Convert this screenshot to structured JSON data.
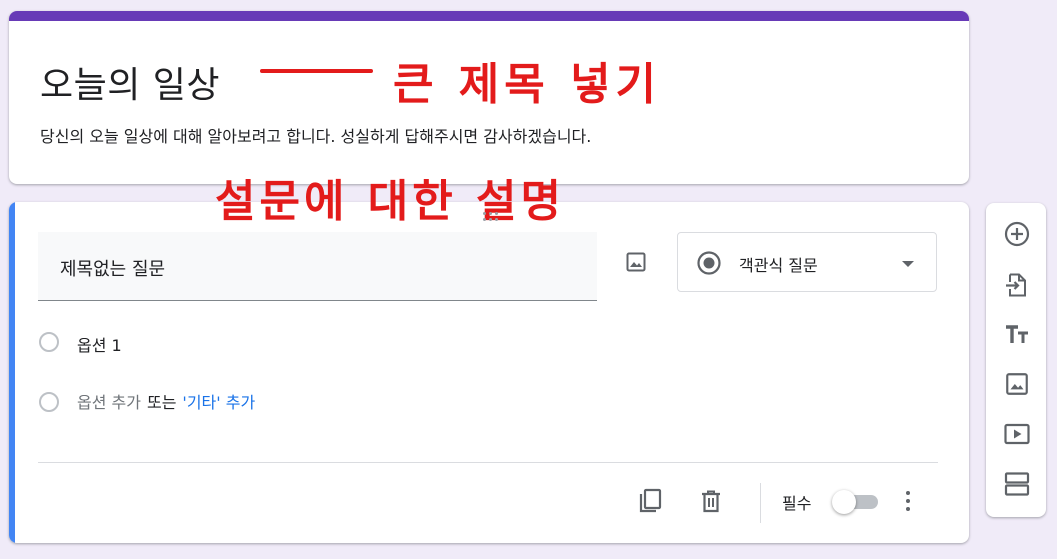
{
  "form": {
    "title": "오늘의 일상",
    "description": "당신의 오늘 일상에 대해 알아보려고 합니다. 성실하게 답해주시면 감사하겠습니다."
  },
  "annotations": {
    "title_note": "큰 제목 넣기",
    "description_note": "설문에 대한 설명"
  },
  "question": {
    "title": "제목없는 질문",
    "type": "객관식 질문",
    "options": [
      "옵션 1"
    ],
    "add_option": "옵션 추가",
    "or_text": "또는",
    "add_other": "'기타' 추가",
    "required_label": "필수",
    "required": false
  },
  "icons": {
    "question_image": "image-icon",
    "type_radio": "radio-checked-icon",
    "type_caret": "caret-down-icon",
    "duplicate": "copy-icon",
    "delete": "trash-icon",
    "more": "more-vert-icon",
    "drag": "drag-handle-icon"
  },
  "side_toolbar": [
    {
      "name": "add-question",
      "icon": "add-circle-icon"
    },
    {
      "name": "import-questions",
      "icon": "import-icon"
    },
    {
      "name": "add-title",
      "icon": "title-text-icon"
    },
    {
      "name": "add-image",
      "icon": "image-icon"
    },
    {
      "name": "add-video",
      "icon": "video-icon"
    },
    {
      "name": "add-section",
      "icon": "section-icon"
    }
  ],
  "colors": {
    "theme": "#673ab7",
    "active_accent": "#4285f4",
    "annotation": "#e31b1b",
    "link": "#1a73e8",
    "background": "#f0ebf8"
  }
}
